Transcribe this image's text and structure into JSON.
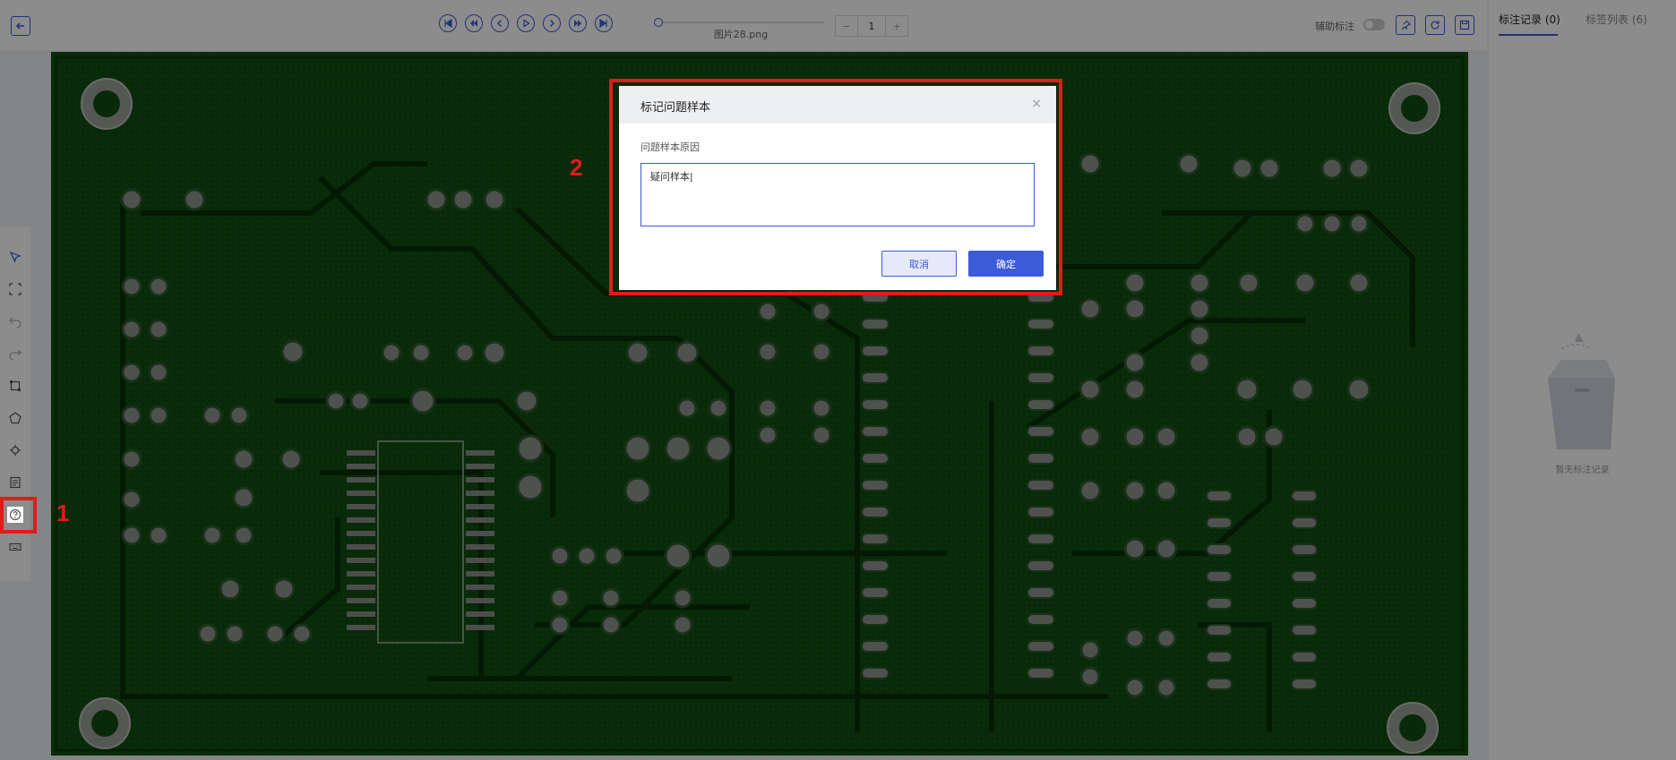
{
  "toolbar": {
    "filename": "图片28.png",
    "page_value": "1",
    "minus_label": "−",
    "plus_label": "+",
    "assist_label": "辅助标注"
  },
  "right_panel": {
    "tab_records": "标注记录 (0)",
    "tab_labels": "标签列表 (6)",
    "empty_text": "暂无标注记录"
  },
  "dialog": {
    "title": "标记问题样本",
    "close": "×",
    "reason_label": "问题样本原因",
    "reason_value": "疑问样本|",
    "cancel_label": "取消",
    "confirm_label": "确定"
  },
  "annotations": {
    "label_1": "1",
    "label_2": "2",
    "color": "#e21b1b"
  },
  "colors": {
    "accent": "#3b5bdb",
    "pcb_green": "#0f4d0f"
  }
}
